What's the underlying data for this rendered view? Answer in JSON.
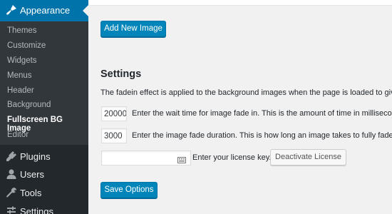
{
  "sidebar": {
    "active_menu": {
      "label": "Appearance",
      "icon": "paintbrush-icon"
    },
    "submenu": [
      {
        "label": "Themes",
        "current": false
      },
      {
        "label": "Customize",
        "current": false
      },
      {
        "label": "Widgets",
        "current": false
      },
      {
        "label": "Menus",
        "current": false
      },
      {
        "label": "Header",
        "current": false
      },
      {
        "label": "Background",
        "current": false
      },
      {
        "label": "Fullscreen BG Image",
        "current": true
      },
      {
        "label": "Editor",
        "current": false
      }
    ],
    "menu": [
      {
        "label": "Plugins",
        "icon": "plugin-icon"
      },
      {
        "label": "Users",
        "icon": "user-icon"
      },
      {
        "label": "Tools",
        "icon": "wrench-icon"
      },
      {
        "label": "Settings",
        "icon": "settings-icon"
      }
    ]
  },
  "main": {
    "add_image_label": "Add New Image",
    "settings_title": "Settings",
    "fadein_description": "The fadein effect is applied to the background images when the page is loaded to give",
    "wait_time": {
      "value": "20000",
      "description": "Enter the wait time for image fade in. This is the amount of time in milliseconds"
    },
    "fade_duration": {
      "value": "3000",
      "description": "Enter the image fade duration. This is how long an image takes to fully fade in"
    },
    "license": {
      "value": "",
      "description": "Enter your license key.",
      "deactivate_label": "Deactivate License"
    },
    "save_label": "Save Options"
  },
  "colors": {
    "accent": "#0073aa",
    "button": "#0085ba",
    "sidebar": "#23282d",
    "submenu": "#32373c"
  }
}
